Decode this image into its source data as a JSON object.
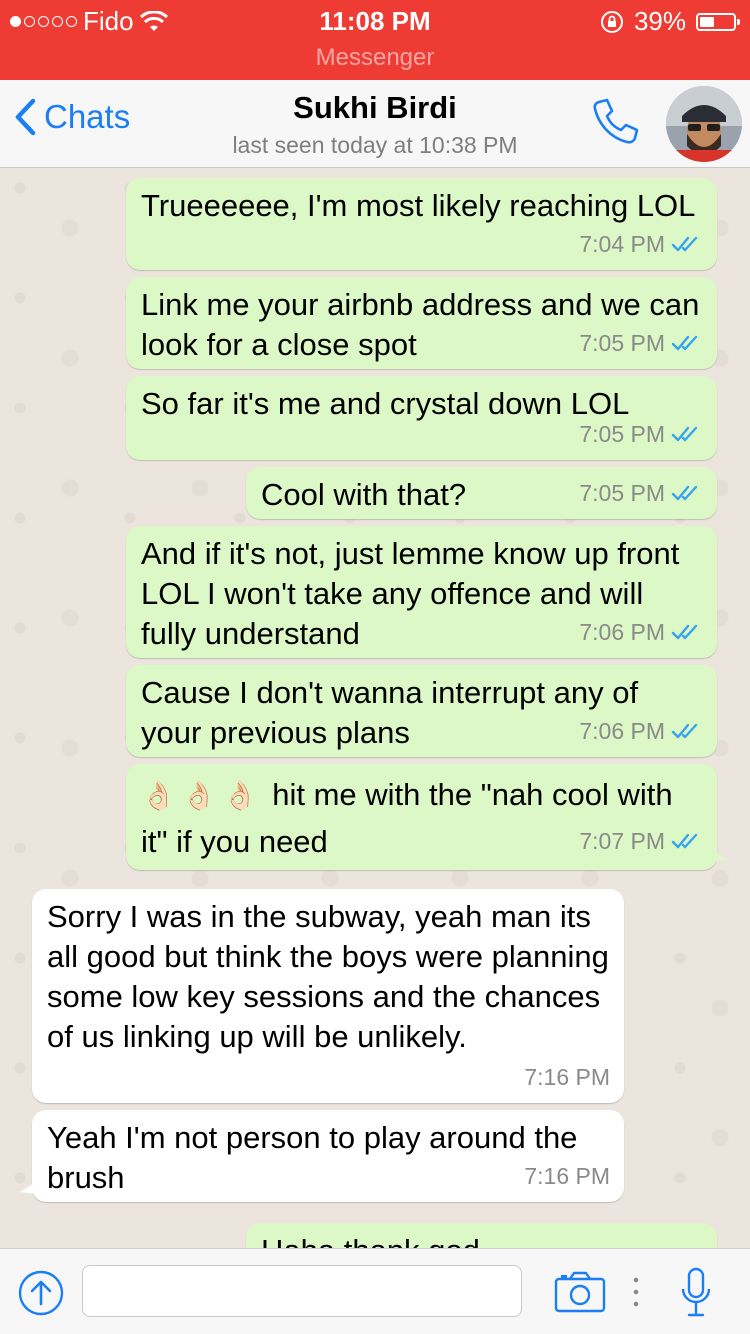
{
  "status_bar": {
    "carrier": "Fido",
    "time": "11:08 PM",
    "battery": "39%",
    "battery_level": 0.39,
    "app_label": "Messenger",
    "colors": {
      "background": "#ee3b33"
    }
  },
  "header": {
    "back_label": "Chats",
    "contact_name": "Sukhi Birdi",
    "last_seen": "last seen today at 10:38 PM",
    "accent": "#1b7ef5"
  },
  "messages": [
    {
      "text": "Trueeeeee, I'm most likely reaching LOL",
      "time": "7:04 PM",
      "direction": "outgoing",
      "read": true
    },
    {
      "text": "Link me your airbnb address and we can look for a close spot",
      "time": "7:05 PM",
      "direction": "outgoing",
      "read": true
    },
    {
      "text": "So far it's me and crystal down LOL",
      "time": "7:05 PM",
      "direction": "outgoing",
      "read": true
    },
    {
      "text": "Cool with that?",
      "time": "7:05 PM",
      "direction": "outgoing",
      "read": true
    },
    {
      "text": "And if it's not, just lemme know up front LOL I won't take any offence and will fully understand",
      "time": "7:06 PM",
      "direction": "outgoing",
      "read": true
    },
    {
      "text": "Cause I don't wanna interrupt any of your previous plans",
      "time": "7:06 PM",
      "direction": "outgoing",
      "read": true
    },
    {
      "emoji": "👌🏻👌🏻👌🏻",
      "text": "hit me with the \"nah cool with it\" if you need",
      "time": "7:07 PM",
      "direction": "outgoing",
      "read": true
    },
    {
      "text": "Sorry I was in the subway, yeah man its all good but think the boys were planning some low key sessions and the chances of us linking up will be unlikely.",
      "time": "7:16 PM",
      "direction": "incoming"
    },
    {
      "text": "Yeah I'm not person to play around the brush",
      "time": "7:16 PM",
      "direction": "incoming"
    },
    {
      "text": "Haha thank god",
      "direction": "outgoing",
      "partial": true
    }
  ],
  "input_bar": {
    "value": "",
    "placeholder": ""
  },
  "icons": {
    "wifi": "wifi-icon",
    "lock_rotation": "rotation-lock-icon",
    "back": "chevron-left-icon",
    "call": "phone-icon",
    "upload": "upload-icon",
    "camera": "camera-icon",
    "more": "more-vertical-icon",
    "mic": "microphone-icon",
    "read_receipt": "double-check-icon"
  }
}
